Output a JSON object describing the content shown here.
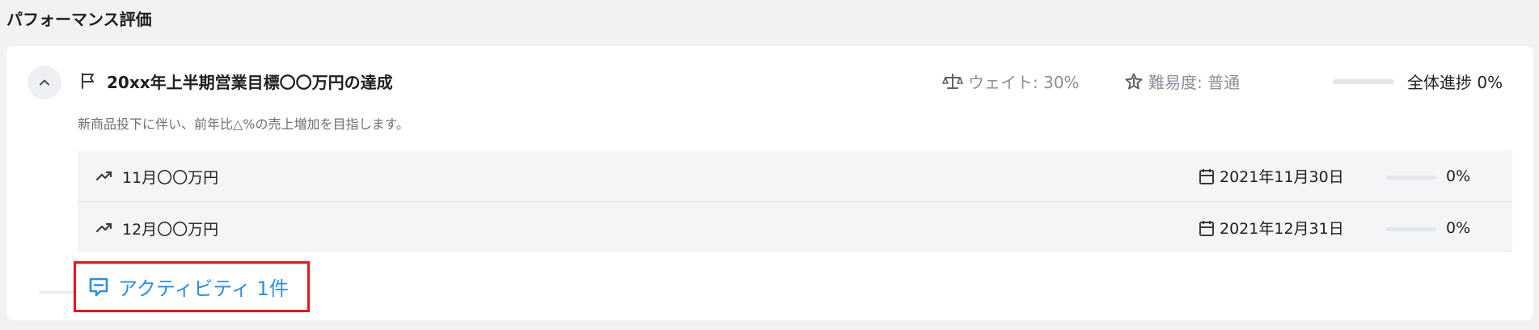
{
  "section": {
    "title": "パフォーマンス評価"
  },
  "goal": {
    "title": "20xx年上半期営業目標〇〇万円の達成",
    "description": "新商品投下に伴い、前年比△%の売上増加を目指します。",
    "weight_label": "ウェイト: 30%",
    "difficulty_label": "難易度: 普通",
    "overall_label": "全体進捗 0%",
    "overall_progress": 0
  },
  "key_results": [
    {
      "label": "11月〇〇万円",
      "due_date": "2021年11月30日",
      "progress": 0,
      "progress_label": "0%"
    },
    {
      "label": "12月〇〇万円",
      "due_date": "2021年12月31日",
      "progress": 0,
      "progress_label": "0%"
    }
  ],
  "activity": {
    "label": "アクティビティ 1件"
  },
  "colors": {
    "accent": "#2a8ee8",
    "highlight_border": "#e8141b",
    "muted_text": "#8a8f98",
    "row_background": "#f4f5f7"
  },
  "icons": {
    "collapse": "chevron-up-icon",
    "goal": "flag-icon",
    "weight": "scale-icon",
    "difficulty": "star-icon",
    "key_result": "trending-up-icon",
    "date": "calendar-icon",
    "activity": "comment-icon"
  }
}
